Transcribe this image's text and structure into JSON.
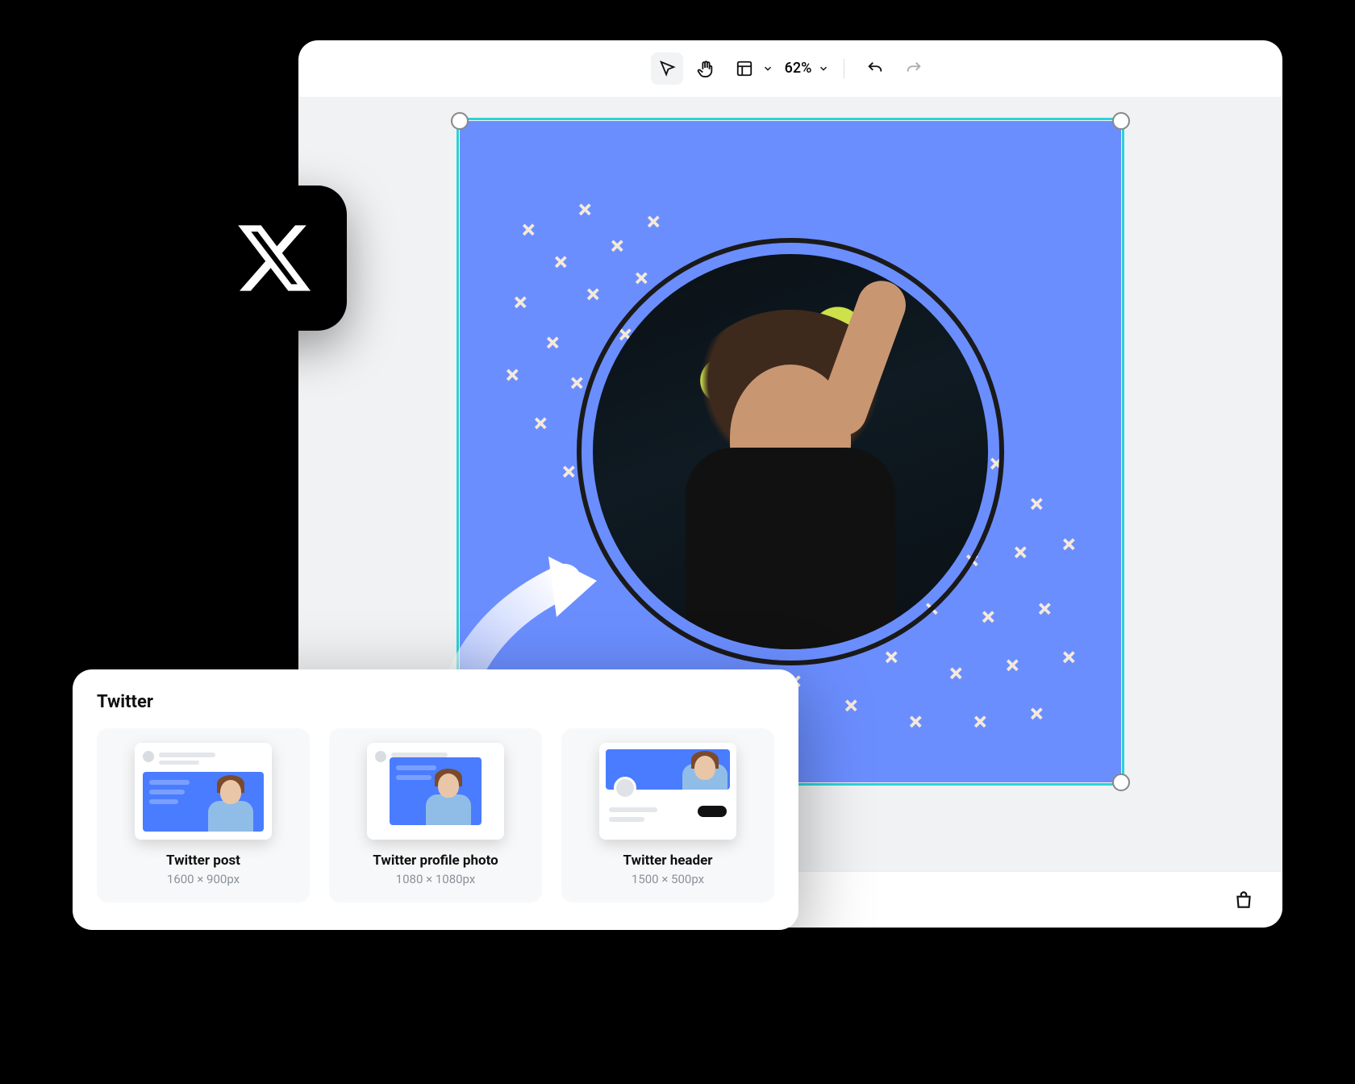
{
  "toolbar": {
    "zoom_label": "62%"
  },
  "panel": {
    "title": "Twitter",
    "cards": [
      {
        "title": "Twitter post",
        "dims": "1600 × 900px"
      },
      {
        "title": "Twitter profile photo",
        "dims": "1080 × 1080px"
      },
      {
        "title": "Twitter header",
        "dims": "1500 × 500px"
      }
    ]
  },
  "icons": {
    "cursor": "cursor-icon",
    "hand": "hand-icon",
    "layout": "layout-icon",
    "chevron_down": "chevron-down-icon",
    "undo": "undo-icon",
    "redo": "redo-icon",
    "shopping_bag": "shopping-bag-icon",
    "x_logo": "x-logo-icon"
  },
  "colors": {
    "canvas_bg": "#f0f2f4",
    "artboard_bg": "#6b8eff",
    "selection": "#2ad4d4",
    "cross_pattern": "#f5e9d9",
    "accent_blue": "#4a7cff"
  }
}
